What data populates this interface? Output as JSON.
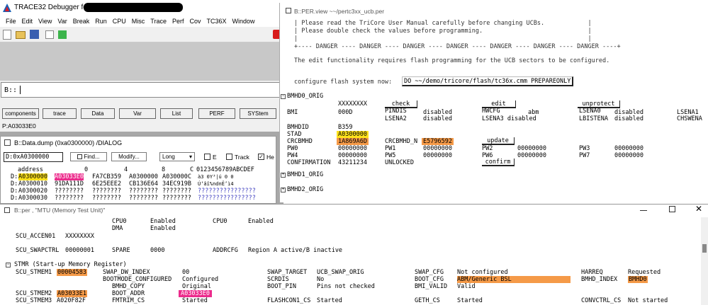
{
  "main": {
    "title": "TRACE32 Debugger for",
    "menu": [
      "File",
      "Edit",
      "View",
      "Var",
      "Break",
      "Run",
      "CPU",
      "Misc",
      "Trace",
      "Perf",
      "Cov",
      "TC36X",
      "Window"
    ],
    "cmd_prompt": "B::",
    "buttons": [
      "components",
      "trace",
      "Data",
      "Var",
      "List",
      "PERF",
      "SYStem"
    ],
    "status": "P:A03033E0"
  },
  "dump": {
    "title": "B::Data.dump (0xa0300000) /DIALOG",
    "addr_value": "D:0xA0300000",
    "find": "Find...",
    "modify": "Modify...",
    "width": "Long",
    "opt_e": "E",
    "opt_track": "Track",
    "opt_he": "He",
    "header": {
      "address": "address",
      "c0": "0",
      "c4": "4",
      "c8": "8",
      "cC": "C",
      "ascii": "0123456789ABCDEF"
    },
    "rows": [
      {
        "pfx": "D:",
        "addr": "A0300000",
        "v0": "A03033E0",
        "v4": "FA7CB359",
        "v8": "A0300000",
        "vC": "A030000C",
        "asc": "à3 0Y³|ú 0 0 "
      },
      {
        "pfx": "D:",
        "addr": "A0300010",
        "v0": "91DA111D",
        "v4": "6E25EEE2",
        "v8": "CB136E64",
        "vC": "34EC919B",
        "asc": "Ú‘âî%ndnË’ì4"
      },
      {
        "pfx": "D:",
        "addr": "A0300020",
        "v0": "????????",
        "v4": "????????",
        "v8": "????????",
        "vC": "????????",
        "asc": "????????????????"
      },
      {
        "pfx": "D:",
        "addr": "A0300030",
        "v0": "????????",
        "v4": "????????",
        "v8": "????????",
        "vC": "????????",
        "asc": "????????????????"
      }
    ]
  },
  "per": {
    "title": "B::PER.view ~~/pertc3xx_ucb.per",
    "warn1": "| Please read the TriCore User Manual carefully before changing UCBs.            |",
    "warn2": "| Please double check the values before programming.                             |",
    "warn3": "|                                                                                |",
    "warn4": "+---- DANGER ---- DANGER ---- DANGER ---- DANGER ---- DANGER ---- DANGER ---- DANGER ----+",
    "note": "The edit functionality requires flash programming for the UCB sectors to be configured.",
    "config_label": "configure flash system now:",
    "config_cmd": "DO ~~/demo/tricore/flash/tc36x.cmm PREPAREONLY",
    "section1": "BMHD0_ORIG",
    "section2": "BMHD1_ORIG",
    "section3": "BMHD2_ORIG",
    "btn_check": "check",
    "btn_edit": "edit",
    "btn_unprotect": "unprotect",
    "btn_update": "update",
    "btn_confirm": "confirm",
    "xxx": "XXXXXXXX",
    "bmi": "BMI",
    "bmi_val": "000D",
    "pindis": "PINDIS",
    "pindis_val": "disabled",
    "hwcfg": "HWCFG",
    "hwcfg_val": "abm",
    "lsena0": "LSENA0",
    "lsena0_val": "disabled",
    "lsena1": "LSENA1",
    "lsena2": "LSENA2",
    "lsena2_val": "disabled",
    "lsena3": "LSENA3 disabled",
    "lbistena": "LBISTENA",
    "lbistena_val": "disabled",
    "chswena": "CHSWENA",
    "bmhdid": "BMHDID",
    "bmhdid_val": "B359",
    "stad": "STAD",
    "stad_val": "A0300000",
    "crcbmhd": "CRCBMHD",
    "crcbmhd_val": "1A869A6D",
    "crcbmhd_n": "CRCBMHD_N",
    "crcbmhd_n_val": "E5796592",
    "pw0": "PW0",
    "pw0v": "00000000",
    "pw1": "PW1",
    "pw1v": "00000000",
    "pw2": "PW2",
    "pw2v": "00000000",
    "pw3": "PW3",
    "pw3v": "00000000",
    "pw4": "PW4",
    "pw4v": "00000000",
    "pw5": "PW5",
    "pw5v": "00000000",
    "pw6": "PW6",
    "pw6v": "00000000",
    "pw7": "PW7",
    "pw7v": "00000000",
    "confirmation": "CONFIRMATION",
    "confirmation_val": "43211234",
    "unlocked": "UNLOCKED"
  },
  "mtu": {
    "title": "B::per , \"MTU (Memory Test Unit)\"",
    "cpu0a": "CPU0",
    "cpu0a_v": "Enabled",
    "cpu0b": "CPU0",
    "cpu0b_v": "Enabled",
    "dma": "DMA",
    "dma_v": "Enabled",
    "accen": "SCU_ACCEN01",
    "accen_v": "XXXXXXXX",
    "swapctrl": "SCU_SWAPCTRL",
    "swapctrl_v": "00000001",
    "spare": "SPARE",
    "spare_v": "0000",
    "addrcfg": "ADDRCFG",
    "addrcfg_v": "Region A active/B inactive",
    "stmr": "STMR (Start-up Memory Register)",
    "stmem1": "SCU_STMEM1",
    "stmem1_v": "00004583",
    "swap_dw": "SWAP_DW_INDEX",
    "swap_dw_v": "00",
    "swap_target": "SWAP_TARGET",
    "swap_target_v": "UCB_SWAP_ORIG",
    "swap_cfg": "SWAP_CFG",
    "swap_cfg_v": "Not configured",
    "harreq": "HARREQ",
    "harreq_v": "Requested",
    "bootmode": "BOOTMODE_CONFIGURED",
    "bootmode_v": "Configured",
    "scrdis": "SCRDIS",
    "scrdis_v": "No",
    "boot_cfg": "BOOT_CFG",
    "boot_cfg_v": "ABM/Generic BSL",
    "bmhd_index": "BMHD_INDEX",
    "bmhd_index_v": "BMHD0",
    "bmhd_copy": "BMHD_COPY",
    "bmhd_copy_v": "Original",
    "boot_pin": "BOOT_PIN",
    "boot_pin_v": "Pins not checked",
    "bmi_valid": "BMI_VALID",
    "bmi_valid_v": "Valid",
    "stmem2": "SCU_STMEM2",
    "stmem2_v": "A03033E1",
    "boot_addr": "BOOT_ADDR",
    "boot_addr_v": "A03033E0",
    "stmem3": "SCU_STMEM3",
    "stmem3_v": "A020F82F",
    "fmtrim": "FMTRIM_CS",
    "fmtrim_v": "Started",
    "flashcon": "FLASHCON1_CS",
    "flashcon_v": "Started",
    "geth": "GETH_CS",
    "geth_v": "Started",
    "convctrl": "CONVCTRL_CS",
    "convctrl_v": "Not started"
  },
  "colors": {
    "yellow": "#ffe21c",
    "orange": "#f59a48",
    "magenta": "#ec2b8c"
  }
}
